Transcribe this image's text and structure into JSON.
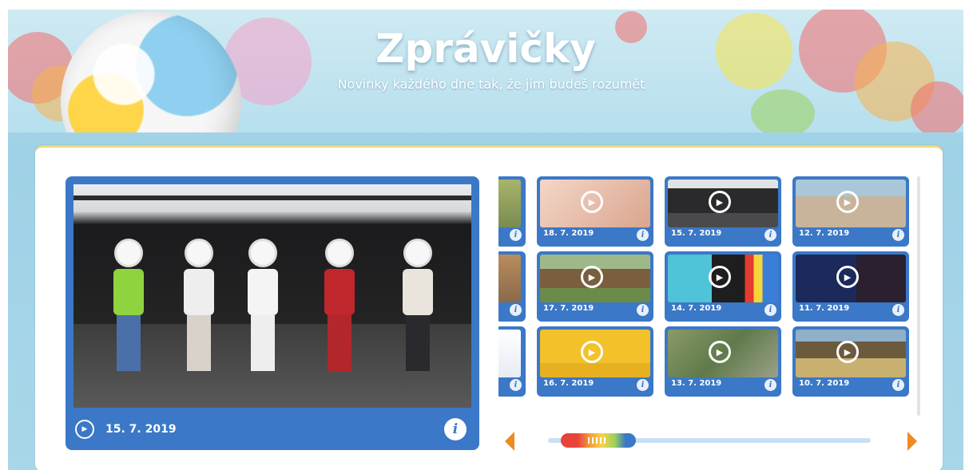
{
  "header": {
    "title": "Zprávičky",
    "subtitle": "Novinky každého dne tak, že jim budeš rozumět"
  },
  "player": {
    "date": "15. 7. 2019",
    "info_label": "i",
    "play_icon": "play-circle-icon"
  },
  "thumbnails": [
    {
      "date": "18. 7. 2019",
      "info_label": "i"
    },
    {
      "date": "15. 7. 2019",
      "info_label": "i"
    },
    {
      "date": "12. 7. 2019",
      "info_label": "i"
    },
    {
      "date": "17. 7. 2019",
      "info_label": "i"
    },
    {
      "date": "14. 7. 2019",
      "info_label": "i"
    },
    {
      "date": "11. 7. 2019",
      "info_label": "i"
    },
    {
      "date": "16. 7. 2019",
      "info_label": "i"
    },
    {
      "date": "13. 7. 2019",
      "info_label": "i"
    },
    {
      "date": "10. 7. 2019",
      "info_label": "i"
    }
  ],
  "partial_info": [
    "i",
    "i",
    "i"
  ],
  "colors": {
    "accent_blue": "#3b78c7",
    "arrow_orange": "#f08a24",
    "panel_bg": "#ffffff"
  }
}
